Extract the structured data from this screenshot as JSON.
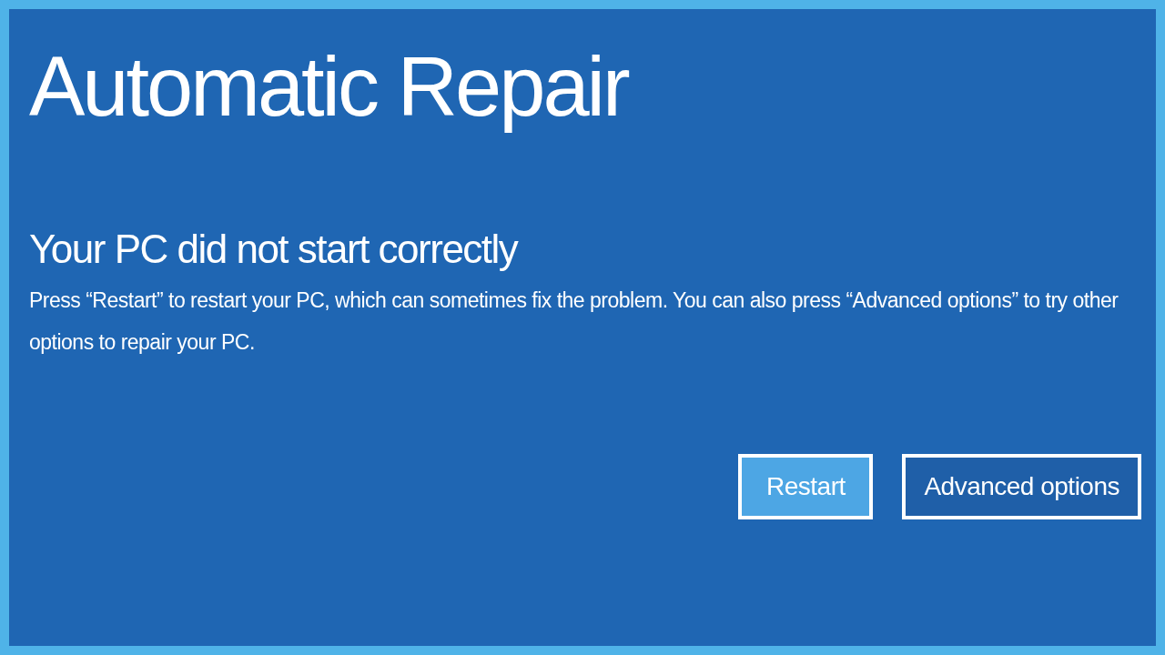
{
  "title": "Automatic Repair",
  "heading": "Your PC did not start correctly",
  "message": "Press “Restart” to restart your PC, which can sometimes fix the problem. You can also press “Advanced options” to try other options to repair your PC.",
  "buttons": [
    {
      "label": "Restart",
      "selected": true
    },
    {
      "label": "Advanced options",
      "selected": false
    }
  ]
}
